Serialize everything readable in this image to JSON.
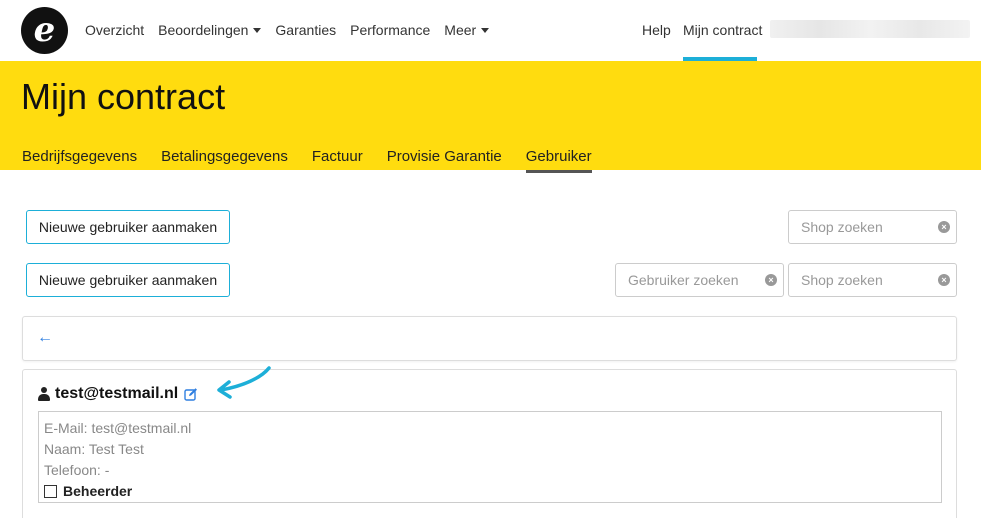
{
  "nav": {
    "logo_letter": "e",
    "items": [
      {
        "label": "Overzicht",
        "dropdown": false
      },
      {
        "label": "Beoordelingen",
        "dropdown": true
      },
      {
        "label": "Garanties",
        "dropdown": false
      },
      {
        "label": "Performance",
        "dropdown": false
      },
      {
        "label": "Meer",
        "dropdown": true
      }
    ],
    "help": "Help",
    "contract": "Mijn contract",
    "accent_color": "#1dafd8"
  },
  "header": {
    "title": "Mijn contract",
    "band_color": "#ffdc0f",
    "tabs": [
      {
        "label": "Bedrijfsgegevens",
        "active": false
      },
      {
        "label": "Betalingsgegevens",
        "active": false
      },
      {
        "label": "Factuur",
        "active": false
      },
      {
        "label": "Provisie Garantie",
        "active": false
      },
      {
        "label": "Gebruiker",
        "active": true
      }
    ]
  },
  "toolbar": {
    "new_user_label": "Nieuwe gebruiker aanmaken",
    "shop_search_placeholder": "Shop zoeken",
    "user_search_placeholder": "Gebruiker zoeken"
  },
  "user": {
    "email": "test@testmail.nl",
    "details": {
      "email_line": "E-Mail: test@testmail.nl",
      "name_line": "Naam: Test Test",
      "phone_line": "Telefoon: -",
      "admin_label": "Beheerder",
      "admin_checked": false
    }
  },
  "icons": {
    "back": "arrow-left-icon",
    "user": "user-icon",
    "edit": "edit-icon",
    "clear": "clear-icon"
  }
}
